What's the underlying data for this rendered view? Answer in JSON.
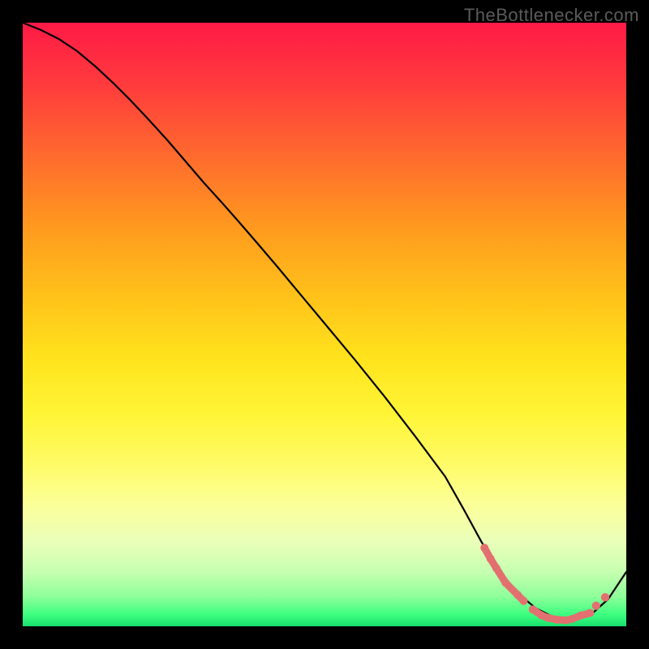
{
  "watermark": "TheBottlenecker.com",
  "chart_data": {
    "type": "line",
    "title": "",
    "xlabel": "",
    "ylabel": "",
    "xlim": [
      0,
      100
    ],
    "ylim": [
      0,
      100
    ],
    "grid": false,
    "legend": false,
    "background_gradient": {
      "top": "#ff1a46",
      "bottom": "#17e06e"
    },
    "series": [
      {
        "name": "bottleneck-curve",
        "color": "#000000",
        "x": [
          0,
          3,
          6,
          9,
          12,
          15,
          18,
          21,
          24,
          27,
          30,
          33,
          36,
          39,
          42,
          45,
          50,
          55,
          60,
          65,
          70,
          73,
          76,
          79,
          82,
          85,
          88,
          91,
          94,
          97,
          100
        ],
        "y": [
          100,
          98.8,
          97.3,
          95.3,
          92.8,
          90.0,
          87.0,
          83.8,
          80.5,
          77.0,
          73.5,
          70.2,
          66.8,
          63.3,
          59.8,
          56.2,
          50.2,
          44.2,
          38.0,
          31.5,
          24.8,
          19.5,
          14.0,
          9.2,
          5.5,
          3.0,
          1.5,
          1.0,
          1.8,
          4.5,
          9.0
        ]
      }
    ],
    "markers": {
      "name": "highlight-dots",
      "color": "#e37070",
      "points": [
        {
          "x": 76.5,
          "y": 13.0
        },
        {
          "x": 77.5,
          "y": 11.2
        },
        {
          "x": 78.5,
          "y": 9.6
        },
        {
          "x": 80.0,
          "y": 7.2
        },
        {
          "x": 82.0,
          "y": 5.2
        },
        {
          "x": 83.0,
          "y": 4.2
        },
        {
          "x": 84.5,
          "y": 2.8
        },
        {
          "x": 86.0,
          "y": 1.8
        },
        {
          "x": 87.0,
          "y": 1.4
        },
        {
          "x": 88.5,
          "y": 1.1
        },
        {
          "x": 90.0,
          "y": 1.0
        },
        {
          "x": 91.0,
          "y": 1.2
        },
        {
          "x": 92.5,
          "y": 1.8
        },
        {
          "x": 94.0,
          "y": 2.2
        },
        {
          "x": 95.0,
          "y": 3.4
        },
        {
          "x": 96.5,
          "y": 4.8
        }
      ]
    }
  }
}
